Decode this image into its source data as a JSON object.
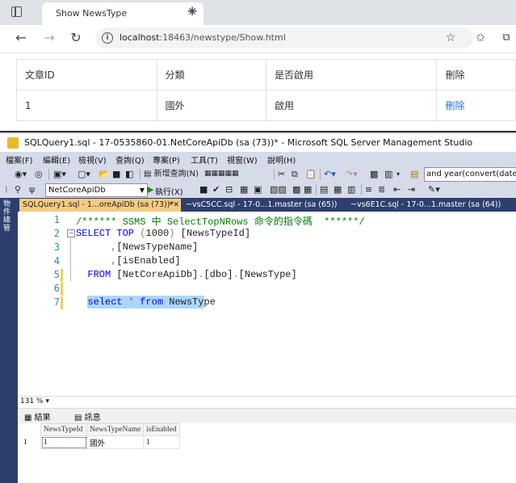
{
  "browser": {
    "tab_title": "Show NewsType",
    "tab_close": "✕",
    "new_tab": "+",
    "url_host": "localhost",
    "url_rest": ":18463/newstype/Show.html",
    "nav_icons": [
      "back-icon",
      "forward-icon",
      "refresh-icon"
    ],
    "toolbar_icons": [
      "favorite-add-icon",
      "favorites-icon",
      "collections-icon"
    ]
  },
  "page_table": {
    "headers": [
      "文章ID",
      "分類",
      "是否啟用",
      "刪除"
    ],
    "rows": [
      [
        "1",
        "國外",
        "啟用",
        "刪除"
      ]
    ]
  },
  "ssms": {
    "title": "SQLQuery1.sql - 17-0535860-01.NetCoreApiDb (sa (73))* - Microsoft SQL Server Management Studio",
    "menu": [
      "檔案(F)",
      "編輯(E)",
      "檢視(V)",
      "查詢(Q)",
      "專案(P)",
      "工具(T)",
      "視窗(W)",
      "說明(H)"
    ],
    "toolbar1": {
      "new_query": "新增查詢(N)",
      "expression": "and year(convert(datetime"
    },
    "toolbar2": {
      "database": "NetCoreApiDb",
      "execute": "執行(X)"
    },
    "side_label": "物件總管",
    "doc_tabs": [
      "SQLQuery1.sql - 1...oreApiDb (sa (73))*",
      "~vsC5CC.sql - 17-0...1.master (sa (65))",
      "~vs6E1C.sql - 17-0...1.master (sa (64))"
    ],
    "editor_lines": [
      {
        "n": "1",
        "text": "/****** SSMS 中 SelectTopNRows 命令的指令碼  ******/"
      },
      {
        "n": "2",
        "text": "SELECT TOP (1000) [NewsTypeId]"
      },
      {
        "n": "3",
        "text": "      ,[NewsTypeName]"
      },
      {
        "n": "4",
        "text": "      ,[isEnabled]"
      },
      {
        "n": "5",
        "text": "  FROM [NetCoreApiDb].[dbo].[NewsType]"
      },
      {
        "n": "6",
        "text": ""
      },
      {
        "n": "7",
        "text": "  select * from NewsType"
      }
    ],
    "zoom": "131 %",
    "result_tabs": [
      "結果",
      "訊息"
    ],
    "result_grid": {
      "columns": [
        "NewsTypeId",
        "NewsTypeName",
        "isEnabled"
      ],
      "rows": [
        {
          "row_num": "1",
          "cells": [
            "1",
            "國外",
            "1"
          ]
        }
      ]
    },
    "colors": {
      "title_bar": "#ffffff",
      "chrome": "#d6dbe9",
      "tab_strip": "#2e3f6e",
      "active_tab": "#f5cc84",
      "keyword": "#0000ff",
      "comment": "#008000",
      "selection": "#add6ff"
    }
  }
}
